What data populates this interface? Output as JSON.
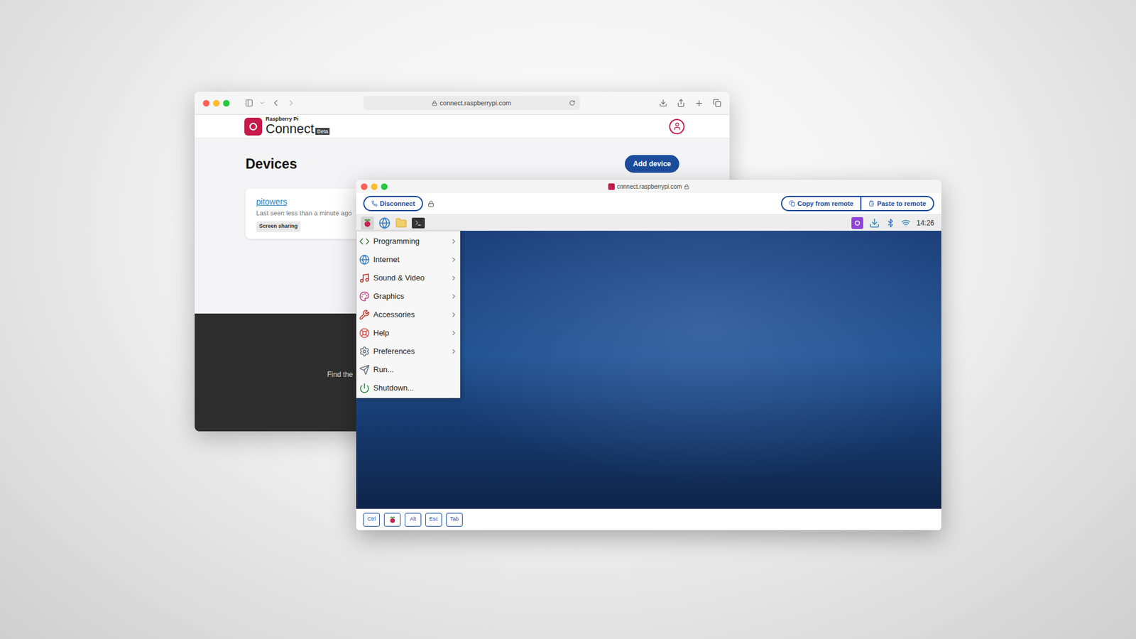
{
  "back_window": {
    "url": "connect.raspberrypi.com",
    "brand": {
      "small": "Raspberry Pi",
      "name": "Connect",
      "badge": "Beta"
    },
    "heading": "Devices",
    "add_button": "Add device",
    "devices": [
      {
        "name": "pitowers",
        "last_seen": "Last seen less than a minute ago",
        "tag": "Screen sharing"
      }
    ],
    "footer_text": "Find the"
  },
  "front_window": {
    "url": "connect.raspberrypi.com",
    "toolbar": {
      "disconnect": "Disconnect",
      "copy": "Copy from remote",
      "paste": "Paste to remote"
    },
    "taskbar": {
      "clock": "14:26"
    },
    "menu": {
      "items": [
        {
          "label": "Programming",
          "submenu": true
        },
        {
          "label": "Internet",
          "submenu": true
        },
        {
          "label": "Sound & Video",
          "submenu": true
        },
        {
          "label": "Graphics",
          "submenu": true
        },
        {
          "label": "Accessories",
          "submenu": true
        },
        {
          "label": "Help",
          "submenu": true
        },
        {
          "label": "Preferences",
          "submenu": true
        },
        {
          "label": "Run...",
          "submenu": false
        },
        {
          "label": "Shutdown...",
          "submenu": false
        }
      ]
    },
    "keys": [
      {
        "kind": "text",
        "label": "Ctrl"
      },
      {
        "kind": "icon",
        "label": ""
      },
      {
        "kind": "text",
        "label": "Alt"
      },
      {
        "kind": "text",
        "label": "Esc"
      },
      {
        "kind": "text",
        "label": "Tab"
      }
    ]
  }
}
